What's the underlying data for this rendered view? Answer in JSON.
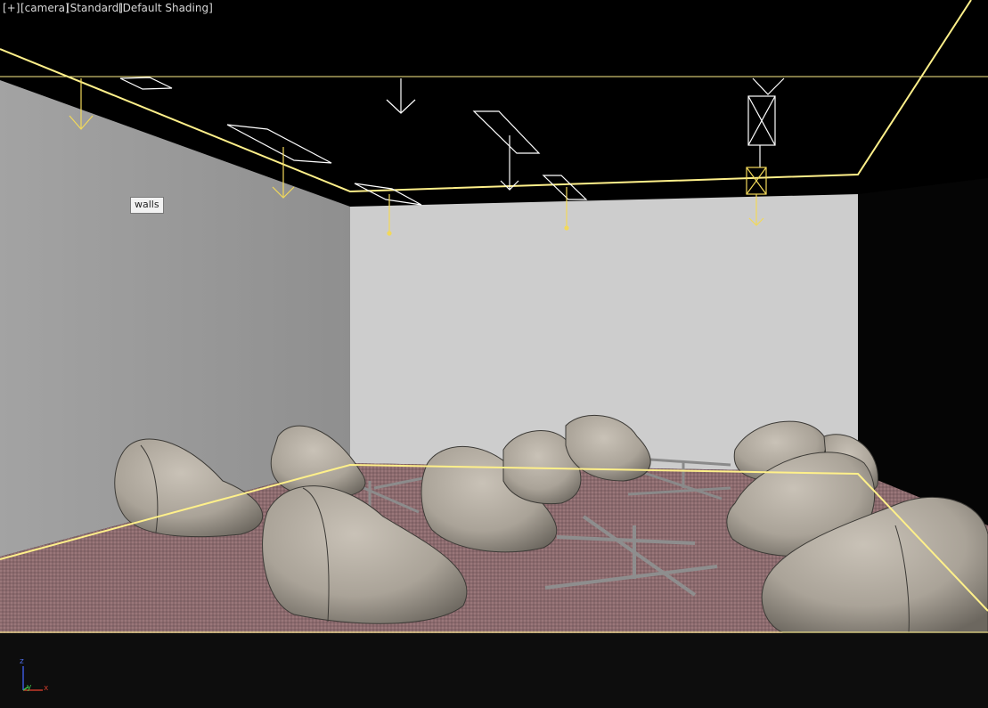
{
  "viewport": {
    "labels": {
      "plus": "[+]",
      "view": "[camera]",
      "mode": "[Standard]",
      "shading": "[Default Shading]"
    },
    "tooltip": "walls",
    "axis": {
      "x": "x",
      "y": "y",
      "z": "z"
    }
  },
  "colors": {
    "selection": "#fff08a",
    "light_gizmo": "#f2d95a",
    "wall_left": "#9b9b9b",
    "wall_back": "#cfcfcf",
    "floor": "#8a6a6c",
    "chair": "#b3aca2",
    "table": "#8e8e8e"
  },
  "icons": [
    "spot-light-icon",
    "camera-target-icon",
    "axis-tripod-icon"
  ]
}
